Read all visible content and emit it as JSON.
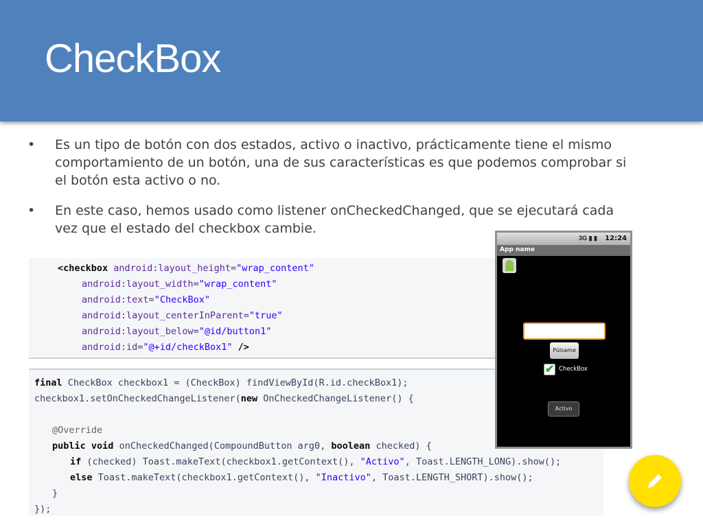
{
  "slide": {
    "title": "CheckBox",
    "bullets": [
      "Es un tipo de botón con dos estados, activo o inactivo, prácticamente tiene el mismo comportamiento de un botón, una de sus características es que podemos comprobar si el botón esta activo o no.",
      "En este caso, hemos usado como listener onCheckedChanged, que se ejecutará cada vez que el estado del checkbox cambie."
    ],
    "bullet_symbol": "•"
  },
  "xml_code": {
    "tag": "<checkbox",
    "attr1": "android:layout_height",
    "val1": "\"wrap_content\"",
    "attr2": "android:layout_width",
    "val2": "\"wrap_content\"",
    "attr3": "android:text",
    "val3": "\"CheckBox\"",
    "attr4": "android:layout_centerInParent",
    "val4": "\"true\"",
    "attr5": "android:layout_below",
    "val5": "\"@id/button1\"",
    "attr6": "android:id",
    "val6": "\"@+id/checkBox1\"",
    "close": " />"
  },
  "java_code": {
    "l1_kw": "final",
    "l1_rest": " CheckBox checkbox1 = (CheckBox) findViewById(R.id.checkBox1);",
    "l2_a": "checkbox1.setOnCheckedChangeListener(",
    "l2_kw": "new",
    "l2_b": " OnCheckedChangeListener() {",
    "l3": "@Override",
    "l4_kw1": "public",
    "l4_kw2": "void",
    "l4_a": " onCheckedChanged(CompoundButton arg0, ",
    "l4_kw3": "boolean",
    "l4_b": " checked) {",
    "l5_kw": "if",
    "l5_a": " (checked) Toast.makeText(checkbox1.getContext(), ",
    "l5_str": "\"Activo\"",
    "l5_b": ", Toast.LENGTH_LONG).show();",
    "l6_kw": "else",
    "l6_a": " Toast.makeText(checkbox1.getContext(), ",
    "l6_str": "\"Inactivo\"",
    "l6_b": ", Toast.LENGTH_SHORT).show();",
    "l7": "}",
    "l8": "});"
  },
  "phone": {
    "status_icons": "3G ▮ ▮",
    "time": "12:24",
    "app_name": "App name",
    "button_label": "Púlsame",
    "checkbox_label": "CheckBox",
    "checkbox_mark": "✔",
    "toast_text": "Activo",
    "edit_field_value": ""
  },
  "icons": {
    "edit_fab": "pencil-icon",
    "fab_color": "#ffe000"
  },
  "colors": {
    "title_bar": "#4f81bd",
    "edit_field_border": "#ff9a2a"
  }
}
